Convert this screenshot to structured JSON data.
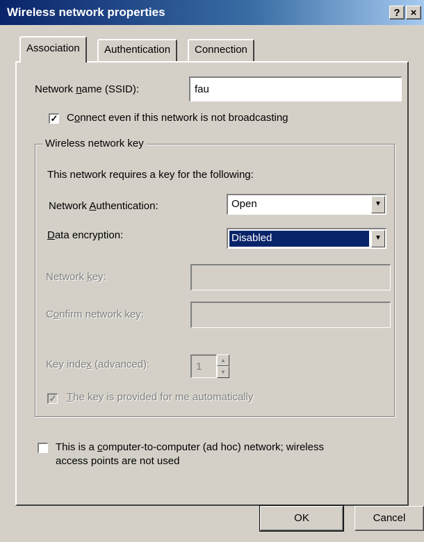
{
  "window": {
    "title": "Wireless network properties",
    "help_button": "?",
    "close_button": "×"
  },
  "tabs": [
    {
      "label": "Association",
      "active": true
    },
    {
      "label": "Authentication",
      "active": false
    },
    {
      "label": "Connection",
      "active": false
    }
  ],
  "association": {
    "ssid_label_pre": "Network ",
    "ssid_label_access": "n",
    "ssid_label_post": "ame (SSID):",
    "ssid_value": "fau",
    "broadcast_checkbox": {
      "checked": true,
      "label_pre": "C",
      "label_access": "o",
      "label_post": "nnect even if this network is not broadcasting"
    },
    "key_group": {
      "title": "Wireless network key",
      "intro": "This network requires a key for the following:",
      "auth_label_pre": "Network ",
      "auth_label_access": "A",
      "auth_label_post": "uthentication:",
      "auth_value": "Open",
      "enc_label_access": "D",
      "enc_label_post": "ata encryption:",
      "enc_value": "Disabled",
      "netkey_label_pre": "Network ",
      "netkey_label_access": "k",
      "netkey_label_post": "ey:",
      "netkey_value": "",
      "confirm_label_pre": "C",
      "confirm_label_access": "o",
      "confirm_label_post": "nfirm network key:",
      "confirm_value": "",
      "index_label_pre": "Key inde",
      "index_label_access": "x",
      "index_label_post": " (advanced):",
      "index_value": "1",
      "auto_checkbox": {
        "checked": true,
        "label_access": "T",
        "label_post": "he key is provided for me automatically"
      }
    },
    "adhoc_checkbox": {
      "checked": false,
      "line1_pre": "This is a ",
      "line1_access": "c",
      "line1_post": "omputer-to-computer (ad hoc) network; wireless",
      "line2": "access points are not used"
    }
  },
  "buttons": {
    "ok": "OK",
    "cancel": "Cancel"
  },
  "icons": {
    "check": "✓",
    "dropdown": "▼",
    "spin_up": "▲",
    "spin_down": "▼"
  }
}
